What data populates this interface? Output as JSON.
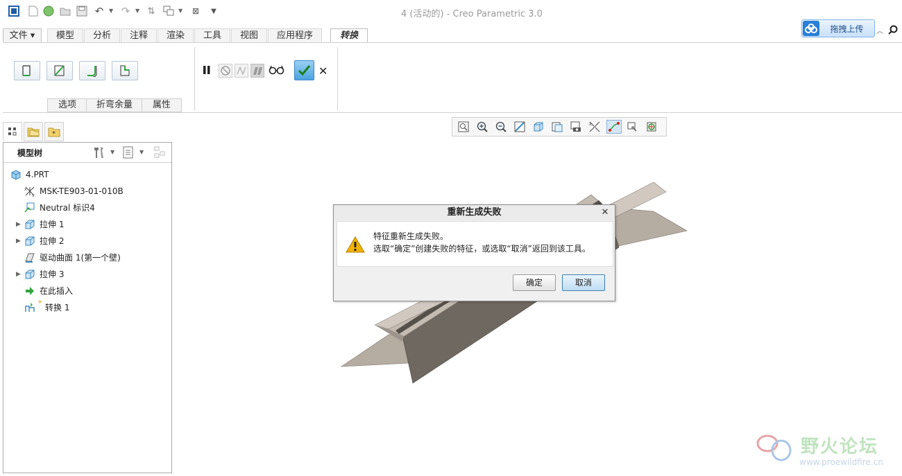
{
  "window": {
    "title": "4 (活动的) - Creo Parametric 3.0"
  },
  "cloud": {
    "label": "拖拽上传"
  },
  "tabs": [
    {
      "label": "文件 ▾"
    },
    {
      "label": "模型"
    },
    {
      "label": "分析"
    },
    {
      "label": "注释"
    },
    {
      "label": "渲染"
    },
    {
      "label": "工具"
    },
    {
      "label": "视图"
    },
    {
      "label": "应用程序"
    },
    {
      "label": "转换"
    }
  ],
  "ribbon": {
    "subtabs": [
      {
        "label": "选项"
      },
      {
        "label": "折弯余量"
      },
      {
        "label": "属性"
      }
    ]
  },
  "tree": {
    "title": "模型树",
    "items": [
      {
        "label": "4.PRT"
      },
      {
        "label": "MSK-TE903-01-010B"
      },
      {
        "label": "Neutral 标识4"
      },
      {
        "label": "拉伸 1"
      },
      {
        "label": "拉伸 2"
      },
      {
        "label": "驱动曲面 1(第一个壁)"
      },
      {
        "label": "拉伸 3"
      },
      {
        "label": "在此插入"
      },
      {
        "label": "转换 1"
      }
    ]
  },
  "dialog": {
    "title": "重新生成失败",
    "message_line1": "特征重新生成失败。",
    "message_line2": "选取“确定”创建失败的特征，或选取“取消”返回到该工具。",
    "ok_label": "确定",
    "cancel_label": "取消"
  },
  "watermark": {
    "name": "野火论坛",
    "url": "www.proewildfire.cn"
  },
  "colors": {
    "accent": "#2a7fd6",
    "confirm": "#4aa3df",
    "warning": "#f2b200",
    "model_top": "#b5aca2",
    "model_side": "#6f6860"
  }
}
